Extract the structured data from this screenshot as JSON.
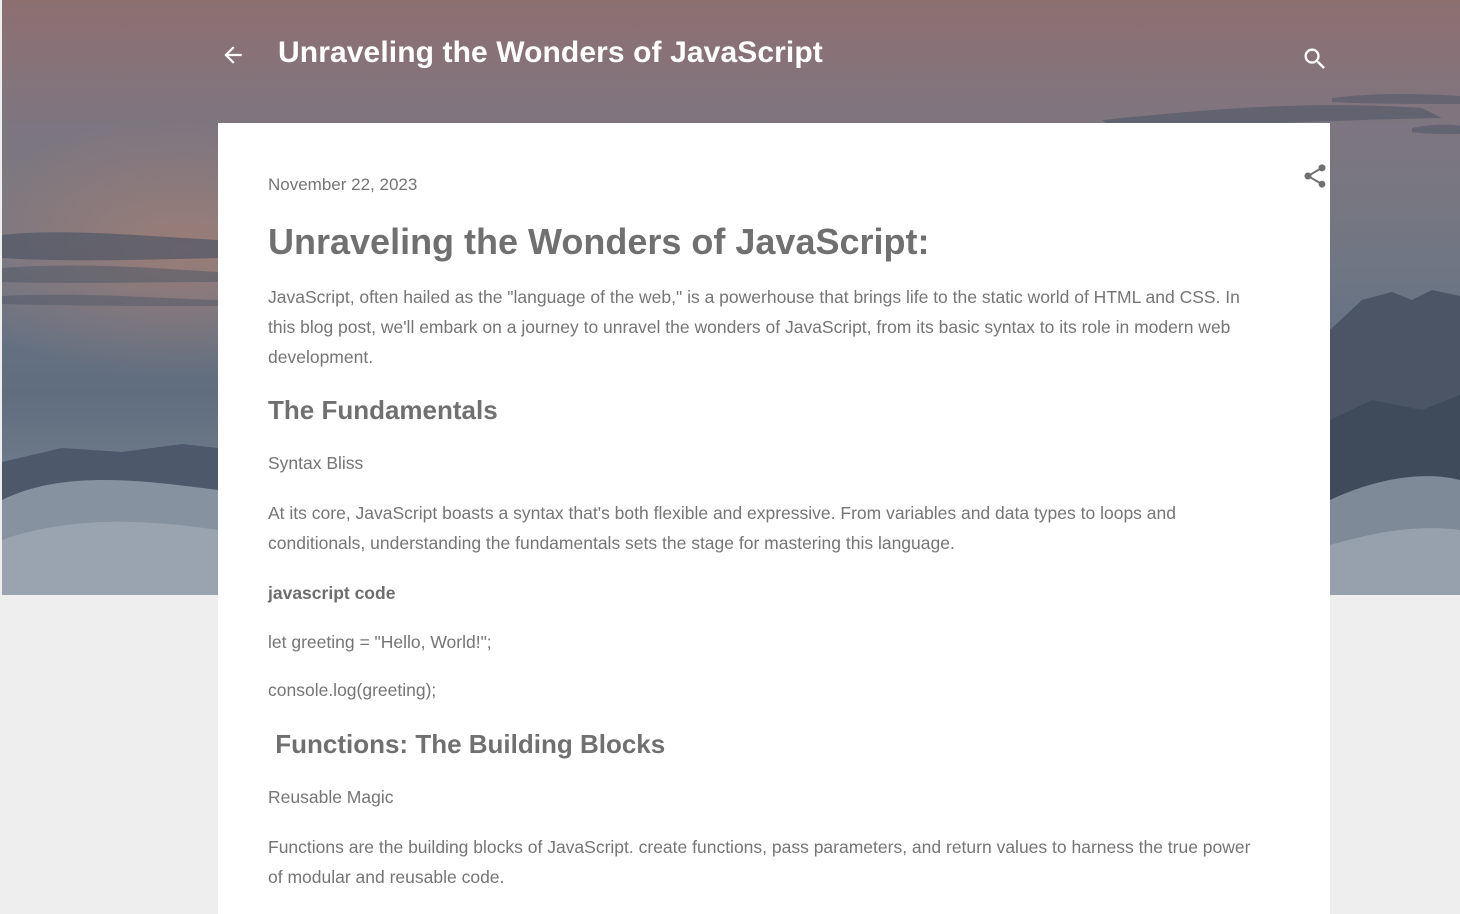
{
  "header": {
    "blog_title": "Unraveling the Wonders of JavaScript",
    "back_icon": "arrow-left-icon",
    "search_icon": "search-icon"
  },
  "post": {
    "date": "November 22, 2023",
    "share_icon": "share-icon",
    "title": "Unraveling the Wonders of JavaScript:",
    "intro": "JavaScript, often hailed as the \"language of the web,\" is a powerhouse that brings life to the static world of HTML and CSS. In this blog post, we'll embark on a journey to unravel the wonders of JavaScript, from its basic syntax to its role in modern web development.",
    "section1": {
      "heading": "The Fundamentals",
      "subheading": "Syntax Bliss",
      "body": "At its core, JavaScript boasts a syntax that's both flexible and expressive. From variables and data types to loops and conditionals, understanding the fundamentals sets the stage for mastering this language.",
      "code_label": "javascript code",
      "code_line1": "let greeting = \"Hello, World!\";",
      "code_line2": "console.log(greeting);"
    },
    "section2": {
      "heading": " Functions: The Building Blocks",
      "subheading": "Reusable Magic",
      "body": "Functions are the building blocks of JavaScript. create functions, pass parameters, and return values to harness the true power of modular and reusable code."
    }
  },
  "colors": {
    "header_text": "#ffffff",
    "body_text": "#757575",
    "card_bg": "#ffffff",
    "page_bg": "#eeeeee"
  }
}
